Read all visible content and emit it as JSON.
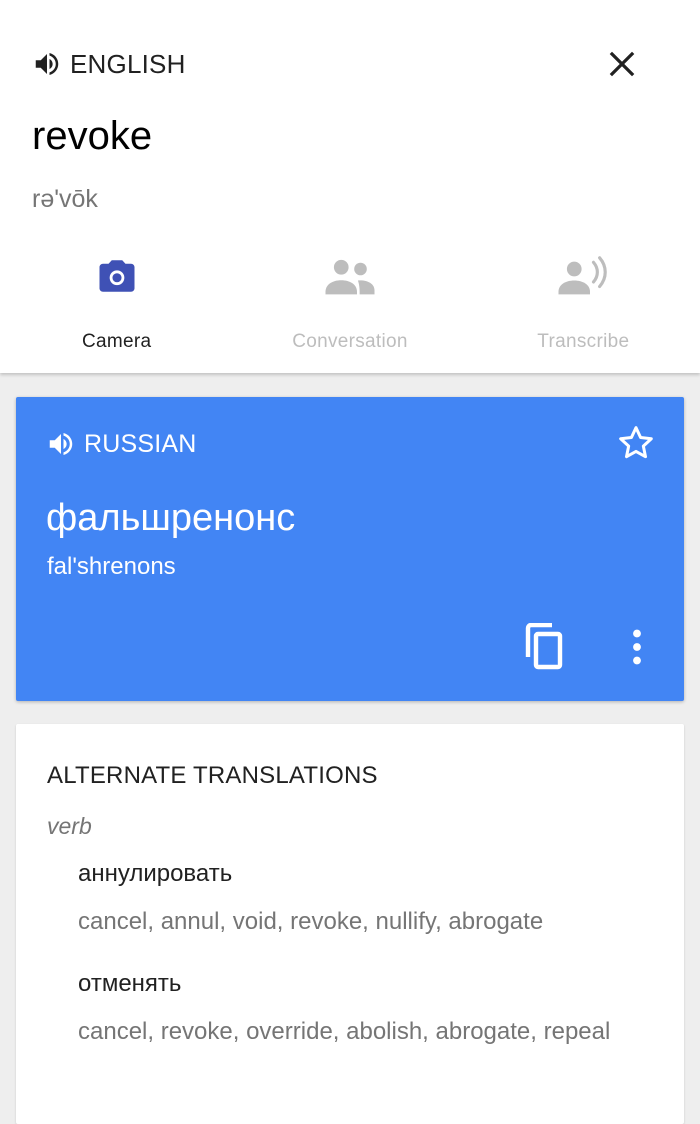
{
  "source": {
    "language": "ENGLISH",
    "text": "revoke",
    "phonetic": "rə'vōk",
    "icons": {
      "speaker": "speaker-icon",
      "close": "close-icon"
    }
  },
  "tools": [
    {
      "label": "Camera",
      "icon": "camera-icon",
      "active": true
    },
    {
      "label": "Conversation",
      "icon": "people-icon",
      "active": false
    },
    {
      "label": "Transcribe",
      "icon": "person-voice-icon",
      "active": false
    }
  ],
  "target": {
    "language": "RUSSIAN",
    "text": "фальшренонс",
    "transliteration": "fal'shrenons",
    "icons": {
      "speaker": "speaker-icon",
      "star": "star-outline-icon",
      "copy": "copy-icon",
      "more": "more-vert-icon"
    }
  },
  "alternates": {
    "title": "ALTERNATE TRANSLATIONS",
    "part_of_speech": "verb",
    "entries": [
      {
        "word": "аннулировать",
        "synonyms": "cancel, annul, void, revoke, nullify, abrogate"
      },
      {
        "word": "отменять",
        "synonyms": "cancel, revoke, override, abolish, abrogate, repeal"
      }
    ]
  },
  "colors": {
    "accent_blue": "#4285f4",
    "camera_icon": "#3f51b5",
    "inactive_icon": "#bdbdbd",
    "background": "#eeeeee"
  }
}
